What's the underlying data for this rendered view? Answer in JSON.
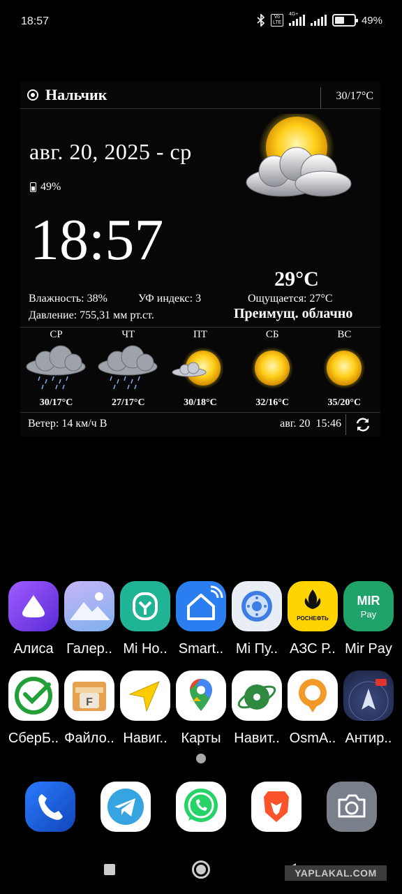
{
  "status_bar": {
    "time": "18:57",
    "volte_text": "Vo LTE",
    "network": "4G+",
    "battery_pct": "49%",
    "battery_level": 0.49,
    "icons": [
      "bluetooth-icon",
      "volte-icon",
      "signal-icon",
      "signal-icon",
      "battery-icon"
    ]
  },
  "weather": {
    "city": "Нальчик",
    "today_hilo": "30/17°C",
    "date": "авг. 20, 2025 - ср",
    "battery": "49%",
    "clock": "18:57",
    "temperature": "29°C",
    "humidity": "Влажность: 38%",
    "uv": "УФ индекс: 3",
    "pressure": "Давление: 755,31 мм рт.ст.",
    "feels_like": "Ощущается: 27°C",
    "condition": "Преимущ. облачно",
    "forecast": [
      {
        "day": "СР",
        "hilo": "30/17°C",
        "icon": "rain-cloud-icon"
      },
      {
        "day": "ЧТ",
        "hilo": "27/17°C",
        "icon": "rain-cloud-icon"
      },
      {
        "day": "ПТ",
        "hilo": "30/18°C",
        "icon": "sun-cloud-icon"
      },
      {
        "day": "СБ",
        "hilo": "32/16°C",
        "icon": "sun-icon"
      },
      {
        "day": "ВС",
        "hilo": "35/20°C",
        "icon": "sun-icon"
      }
    ],
    "wind": "Ветер: 14 км/ч В",
    "updated": "авг. 20  15:46"
  },
  "apps_row1": [
    {
      "label": "Алиса",
      "icon": "alice-icon",
      "color": "#7b3fe4"
    },
    {
      "label": "Галер..",
      "icon": "gallery-icon",
      "color": "#8fb6f0"
    },
    {
      "label": "Mi Ho..",
      "icon": "mi-home-icon",
      "color": "#1fb496"
    },
    {
      "label": "Smart..",
      "icon": "smart-home-icon",
      "color": "#2b7ef0"
    },
    {
      "label": "Mi Пу..",
      "icon": "mi-remote-icon",
      "color": "#e9eef5"
    },
    {
      "label": "АЗС Р..",
      "icon": "rosneft-icon",
      "color": "#ffd400"
    },
    {
      "label": "Mir Pay",
      "icon": "mir-pay-icon",
      "color": "#1fa36a"
    }
  ],
  "apps_row2": [
    {
      "label": "СберБ..",
      "icon": "sberbank-icon",
      "color": "#ffffff"
    },
    {
      "label": "Файло..",
      "icon": "file-manager-icon",
      "color": "#ffffff"
    },
    {
      "label": "Навиг..",
      "icon": "navigator-icon",
      "color": "#ffffff"
    },
    {
      "label": "Карты",
      "icon": "google-maps-icon",
      "color": "#ffffff"
    },
    {
      "label": "Навит..",
      "icon": "navitel-icon",
      "color": "#ffffff"
    },
    {
      "label": "OsmA..",
      "icon": "osmand-icon",
      "color": "#ffffff"
    },
    {
      "label": "Антир..",
      "icon": "antiradar-icon",
      "color": "#2b3560"
    }
  ],
  "app_texts": {
    "mir": "MIR",
    "pay": "Pay",
    "rosneft": "РОСНЕФТЬ",
    "file_letter": "F"
  },
  "dock": [
    {
      "icon": "phone-icon",
      "color": "#1a5fd6"
    },
    {
      "icon": "telegram-icon",
      "color": "#ffffff"
    },
    {
      "icon": "whatsapp-icon",
      "color": "#ffffff"
    },
    {
      "icon": "brave-icon",
      "color": "#ffffff"
    },
    {
      "icon": "camera-icon",
      "color": "#7a7f8c"
    }
  ],
  "watermark": "YAPLAKAL.COM"
}
